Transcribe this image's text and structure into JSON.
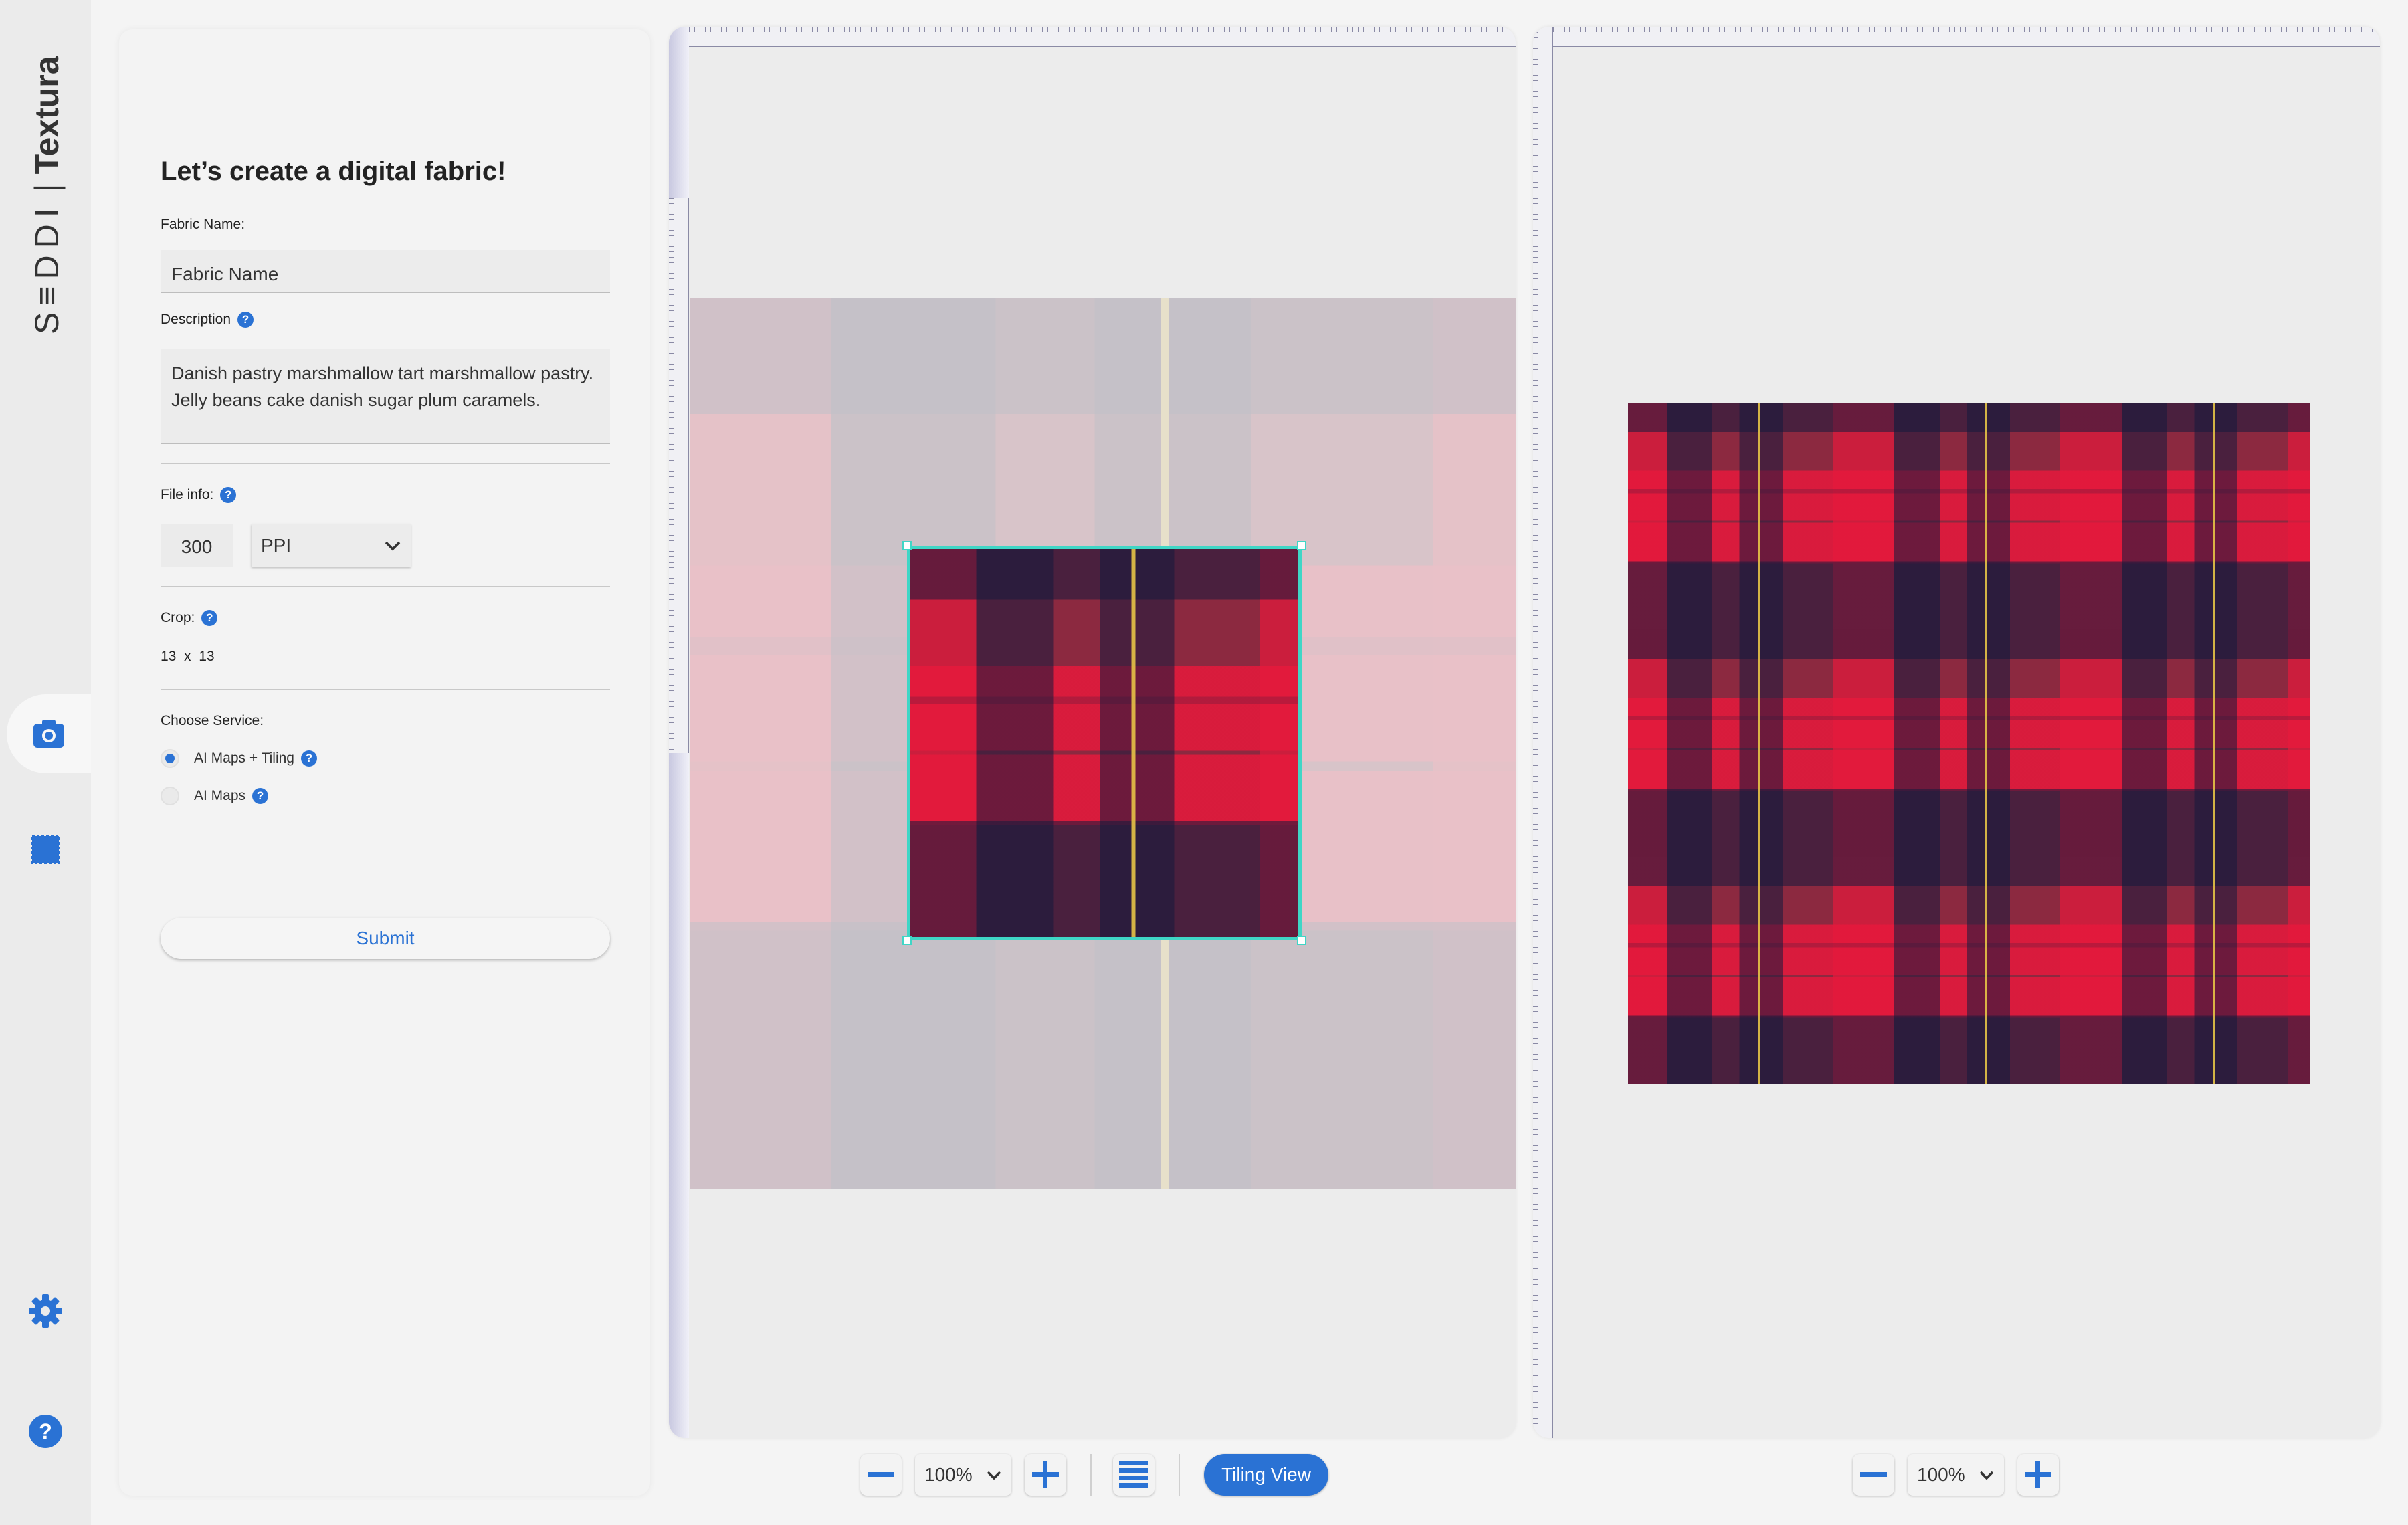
{
  "app": {
    "brand_left": "S≡DDI",
    "brand_right": "Textura"
  },
  "form": {
    "title": "Let’s create a digital fabric!",
    "fabric_name_label": "Fabric Name:",
    "fabric_name_placeholder": "Fabric Name",
    "description_label": "Description",
    "description_value": "Danish pastry marshmallow tart marshmallow pastry. Jelly beans cake danish sugar plum caramels.",
    "file_info_label": "File info:",
    "resolution_value": "300",
    "resolution_unit": "PPI",
    "crop_label": "Crop:",
    "crop_value": "13  x  13",
    "service_label": "Choose Service:",
    "services": [
      {
        "label": "AI Maps + Tiling",
        "selected": true
      },
      {
        "label": "AI Maps",
        "selected": false
      }
    ],
    "submit_label": "Submit"
  },
  "editor": {
    "zoom_left": "100%",
    "zoom_right": "100%",
    "tiling_view_label": "Tiling View"
  },
  "icons": {
    "scan": "camera-icon",
    "fabrics": "fabric-swatch-icon",
    "settings": "gear-icon",
    "help": "help-icon"
  },
  "colors": {
    "accent": "#2a72d4",
    "crop_border": "#3fd6c6"
  }
}
